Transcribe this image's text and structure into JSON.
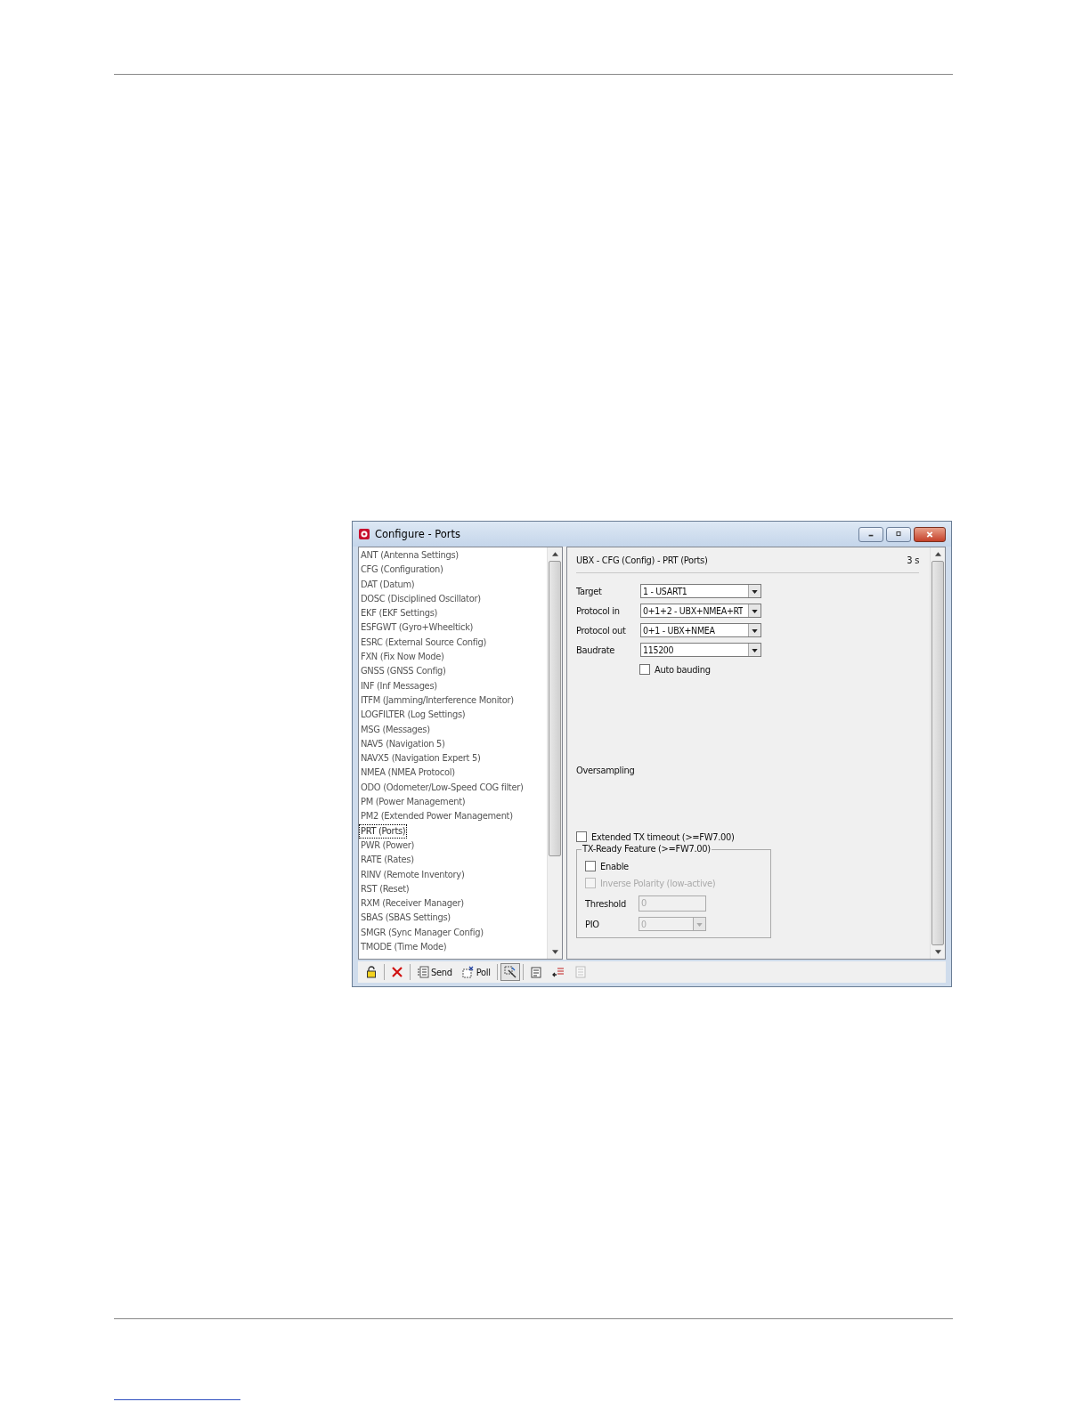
{
  "window": {
    "title": "Configure - Ports"
  },
  "sidebar": {
    "items": [
      {
        "label": "ANT (Antenna Settings)",
        "selected": false
      },
      {
        "label": "CFG (Configuration)",
        "selected": false
      },
      {
        "label": "DAT (Datum)",
        "selected": false
      },
      {
        "label": "DOSC (Disciplined Oscillator)",
        "selected": false
      },
      {
        "label": "EKF (EKF Settings)",
        "selected": false
      },
      {
        "label": "ESFGWT (Gyro+Wheeltick)",
        "selected": false
      },
      {
        "label": "ESRC (External Source Config)",
        "selected": false
      },
      {
        "label": "FXN (Fix Now Mode)",
        "selected": false
      },
      {
        "label": "GNSS (GNSS Config)",
        "selected": false
      },
      {
        "label": "INF (Inf Messages)",
        "selected": false
      },
      {
        "label": "ITFM (Jamming/Interference Monitor)",
        "selected": false
      },
      {
        "label": "LOGFILTER (Log Settings)",
        "selected": false
      },
      {
        "label": "MSG (Messages)",
        "selected": false
      },
      {
        "label": "NAV5 (Navigation 5)",
        "selected": false
      },
      {
        "label": "NAVX5 (Navigation Expert 5)",
        "selected": false
      },
      {
        "label": "NMEA (NMEA Protocol)",
        "selected": false
      },
      {
        "label": "ODO (Odometer/Low-Speed COG filter)",
        "selected": false
      },
      {
        "label": "PM (Power Management)",
        "selected": false
      },
      {
        "label": "PM2 (Extended Power Management)",
        "selected": false
      },
      {
        "label": "PRT (Ports)",
        "selected": true
      },
      {
        "label": "PWR (Power)",
        "selected": false
      },
      {
        "label": "RATE (Rates)",
        "selected": false
      },
      {
        "label": "RINV (Remote Inventory)",
        "selected": false
      },
      {
        "label": "RST (Reset)",
        "selected": false
      },
      {
        "label": "RXM (Receiver Manager)",
        "selected": false
      },
      {
        "label": "SBAS (SBAS Settings)",
        "selected": false
      },
      {
        "label": "SMGR (Sync Manager Config)",
        "selected": false
      },
      {
        "label": "TMODE (Time Mode)",
        "selected": false
      }
    ]
  },
  "panel": {
    "header": "UBX - CFG (Config) - PRT (Ports)",
    "age": "3 s",
    "fields": [
      {
        "kind": "select",
        "label": "Target",
        "value": "1 - USART1"
      },
      {
        "kind": "select",
        "label": "Protocol in",
        "value": "0+1+2 - UBX+NMEA+RT"
      },
      {
        "kind": "select",
        "label": "Protocol out",
        "value": "0+1 - UBX+NMEA"
      },
      {
        "kind": "select",
        "label": "Baudrate",
        "value": "115200"
      },
      {
        "kind": "checkbox",
        "label": "Auto bauding",
        "checked": false
      }
    ],
    "oversampling_label": "Oversampling",
    "extended_tx": {
      "label": "Extended TX timeout (>=FW7.00)",
      "checked": false
    },
    "tx_ready": {
      "title": "TX-Ready Feature (>=FW7.00)",
      "enable": {
        "label": "Enable",
        "checked": false,
        "disabled": false
      },
      "inverse": {
        "label": "Inverse Polarity (low-active)",
        "checked": false,
        "disabled": true
      },
      "threshold": {
        "label": "Threshold",
        "value": "0",
        "disabled": true
      },
      "pio": {
        "label": "PIO",
        "value": "0",
        "disabled": true
      }
    }
  },
  "toolbar": [
    {
      "kind": "lock",
      "pressed": false,
      "disabled": false
    },
    {
      "kind": "separator"
    },
    {
      "kind": "delete",
      "pressed": false,
      "disabled": false
    },
    {
      "kind": "separator"
    },
    {
      "kind": "send",
      "label": "Send",
      "pressed": false,
      "disabled": false
    },
    {
      "kind": "poll",
      "label": "Poll",
      "pressed": false,
      "disabled": false
    },
    {
      "kind": "separator"
    },
    {
      "kind": "wizard",
      "pressed": true,
      "disabled": false
    },
    {
      "kind": "separator"
    },
    {
      "kind": "export",
      "pressed": false,
      "disabled": false
    },
    {
      "kind": "import",
      "pressed": false,
      "disabled": false
    },
    {
      "kind": "document",
      "pressed": false,
      "disabled": true
    }
  ]
}
